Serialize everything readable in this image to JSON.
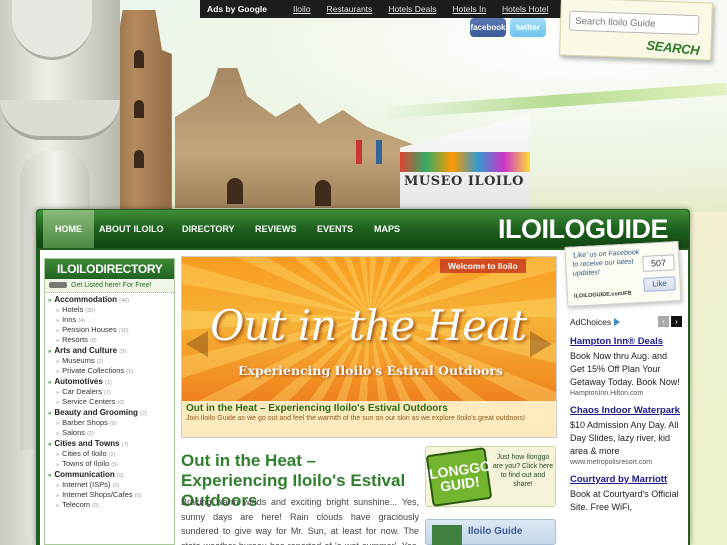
{
  "top_nav": {
    "ads_label": "Ads by Google",
    "links": [
      "Iloilo",
      "Restaurants",
      "Hotels Deals",
      "Hotels In",
      "Hotels Hotel"
    ]
  },
  "social": {
    "facebook": "facebook",
    "twitter": "twitter"
  },
  "search": {
    "placeholder": "Search Iloilo Guide",
    "button_label": "SEARCH"
  },
  "hero": {
    "museum_sign": "MUSEO ILOILO"
  },
  "main_nav": {
    "items": [
      "HOME",
      "ABOUT ILOILO",
      "DIRECTORY",
      "REVIEWS",
      "EVENTS",
      "MAPS"
    ],
    "brand": "ILOILOGUIDE"
  },
  "directory": {
    "title": "ILOILODIRECTORY",
    "listed_text": "Get Listed here! For Free!",
    "categories": [
      {
        "name": "Accommodation",
        "count": "(46)",
        "subs": [
          {
            "name": "Hotels",
            "count": "(30)"
          },
          {
            "name": "Inns",
            "count": "(4)"
          },
          {
            "name": "Pension Houses",
            "count": "(10)"
          },
          {
            "name": "Resorts",
            "count": "(8)"
          }
        ]
      },
      {
        "name": "Arts and Culture",
        "count": "(3)",
        "subs": [
          {
            "name": "Museums",
            "count": "(2)"
          },
          {
            "name": "Private Collections",
            "count": "(1)"
          }
        ]
      },
      {
        "name": "Automotives",
        "count": "(1)",
        "subs": [
          {
            "name": "Car Dealers",
            "count": "(1)"
          },
          {
            "name": "Service Centers",
            "count": "(0)"
          }
        ]
      },
      {
        "name": "Beauty and Grooming",
        "count": "(2)",
        "subs": [
          {
            "name": "Barber Shops",
            "count": "(0)"
          },
          {
            "name": "Salons",
            "count": "(2)"
          }
        ]
      },
      {
        "name": "Cities and Towns",
        "count": "(7)",
        "subs": [
          {
            "name": "Cities of Iloilo",
            "count": "(2)"
          },
          {
            "name": "Towns of Iloilo",
            "count": "(5)"
          }
        ]
      },
      {
        "name": "Communication",
        "count": "(0)",
        "subs": [
          {
            "name": "Internet (ISPs)",
            "count": "(0)"
          },
          {
            "name": "Internet Shops/Cafes",
            "count": "(0)"
          },
          {
            "name": "Telecom",
            "count": "(0)"
          }
        ]
      }
    ]
  },
  "slider": {
    "welcome": "Welcome to Iloilo",
    "headline": "Out in the Heat",
    "tagline": "Experiencing Iloilo's Estival Outdoors",
    "caption_title": "Out in the Heat – Experiencing Iloilo's Estival Outdoors",
    "caption_text": "Join Iloilo Guide as we go out and feel the warmth of the sun on our skin as we explore Iloilo's great outdoors!"
  },
  "article": {
    "title": "Out in the Heat – Experiencing Iloilo's Estival Outdoors",
    "body": "Bracing warm winds and exciting bright sunshine... Yes, sunny days are here! Rain clouds have graciously sundered to give way for Mr. Sun, at least for now. The state weather bureau has reported of 'a wet summer'. Yes, a wet"
  },
  "ilonggo": {
    "logo": "ILONGGO GUID!",
    "text": "Just how Ilonggo are you? Click here to find out and share!"
  },
  "guide_box": {
    "name": "Iloilo Guide"
  },
  "like_box": {
    "text": "'Like' us on Facebook to receive our latest updates!",
    "count": "507",
    "button": "Like",
    "url": "ILOILOGUIDE.com/FB"
  },
  "ads": {
    "adchoices": "AdChoices",
    "items": [
      {
        "title": "Hampton Inn® Deals",
        "desc": "Book Now thru Aug. and Get 15% Off Plan Your Getaway Today. Book Now!",
        "url": "HamptonInn.Hilton.com"
      },
      {
        "title": "Chaos Indoor Waterpark",
        "desc": "$10 Admission Any Day. All Day Slides, lazy river, kid area & more",
        "url": "www.metropolisresort.com"
      },
      {
        "title": "Courtyard by Marriott",
        "desc": "Book at Courtyard's Official Site. Free WiFi,",
        "url": ""
      }
    ]
  },
  "colors": {
    "brand_green": "#1b5c1b",
    "accent_orange": "#f28d22"
  }
}
